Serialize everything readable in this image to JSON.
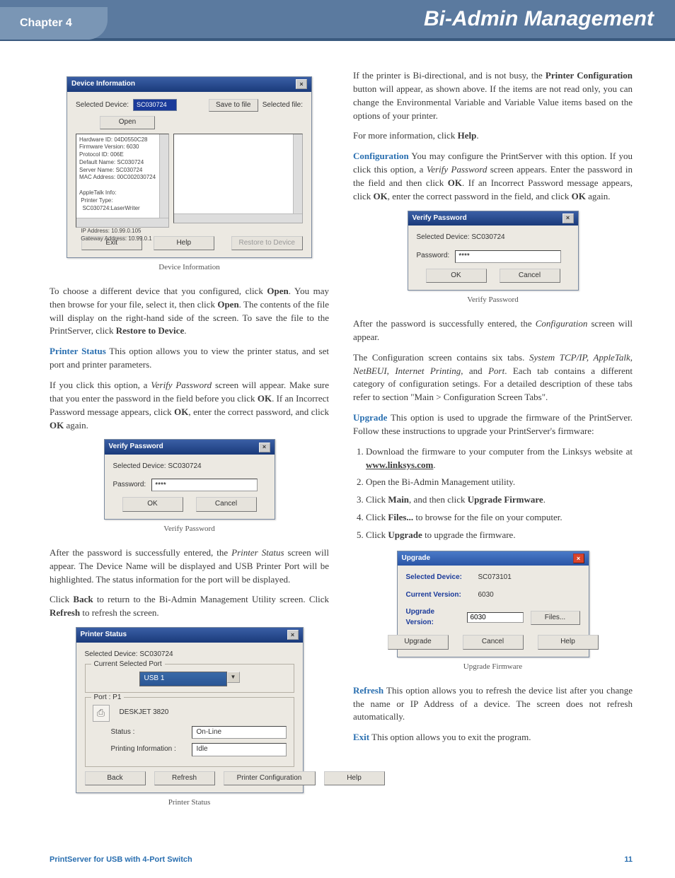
{
  "header": {
    "chapter": "Chapter 4",
    "title": "Bi-Admin Management"
  },
  "footer": {
    "product": "PrintServer for USB with 4-Port Switch",
    "page": "11"
  },
  "left": {
    "dev_info_dialog": {
      "title": "Device Information",
      "selected_label": "Selected Device:",
      "selected_value": "SC030724",
      "save_to_file": "Save to file",
      "selected_file_label": "Selected file:",
      "open": "Open",
      "details": "Hardware ID: 04D0550C28\nFirmware Version: 6030\nProtocol ID: 006E\nDefault Name: SC030724\nServer Name: SC030724\nMAC Address: 00C002030724\n\nAppleTalk Info:\n Printer Type:\n  SC030724:LaserWriter\n\nTCP/IP Info:\n IP Address: 10.99.0.105\n Gateway Address: 10.99.0.1",
      "restore": "Restore to Device",
      "exit": "Exit",
      "help": "Help"
    },
    "caption1": "Device Information",
    "p1a": "To choose a different device that you configured, click ",
    "p1b": ". You may then browse for your file, select it, then click ",
    "p1c": ". The contents of the file will display on the right-hand side of the screen. To save the file to the PrintServer, click ",
    "open_bold": "Open",
    "restore_bold": "Restore to Device",
    "printer_status_label": "Printer Status",
    "p2": " This option allows you to view the printer status, and set port and printer parameters.",
    "p3": "If you click this option, a ",
    "verify_italic": "Verify Password",
    "p3b": " screen will appear. Make sure that you enter the password in the field before you click ",
    "ok_bold": "OK",
    "p3c": ". If an Incorrect Password message appears, click ",
    "p3d": ", enter the correct password, and click ",
    "p3e": " again.",
    "vp_dialog": {
      "title": "Verify Password",
      "selected": "Selected Device:  SC030724",
      "password_label": "Password:",
      "password_value": "****",
      "ok": "OK",
      "cancel": "Cancel"
    },
    "caption2": "Verify Password",
    "p4a": "After the password is successfully entered, the ",
    "p4b": " screen will appear. The Device Name will be displayed and USB Printer Port will be highlighted. The status information for the port will be displayed.",
    "printer_status_italic": "Printer Status",
    "p5a": "Click ",
    "back_bold": "Back",
    "p5b": " to return to the Bi-Admin Management Utility screen. Click ",
    "refresh_bold": "Refresh",
    "p5c": " to refresh the screen.",
    "ps_dialog": {
      "title": "Printer Status",
      "selected": "Selected Device:    SC030724",
      "group1": "Current Selected Port",
      "port_select": "USB 1",
      "group2": "Port : P1",
      "printer": "DESKJET 3820",
      "status_label": "Status :",
      "status_value": "On-Line",
      "printing_label": "Printing Information :",
      "printing_value": "Idle",
      "back": "Back",
      "refresh": "Refresh",
      "printer_config": "Printer Configuration",
      "help": "Help"
    },
    "caption3": "Printer Status"
  },
  "right": {
    "p1a": "If the printer is Bi-directional, and is not busy, the ",
    "printer_config_bold": "Printer Configuration",
    "p1b": " button will appear, as shown above. If the items are not read only, you can change the Environmental Variable and Variable Value items based on the options of your printer.",
    "p2a": "For more information, click ",
    "help_bold": "Help",
    "config_label": "Configuration",
    "p3a": " You may configure the PrintServer with this option. If you click this option, a ",
    "verify_italic": "Verify Password",
    "p3b": " screen appears. Enter the password in the field and then click ",
    "ok_bold": "OK",
    "p3c": ". If an Incorrect Password message appears, click ",
    "p3d": ", enter the correct password in the field, and click ",
    "p3e": " again.",
    "vp_dialog": {
      "title": "Verify Password",
      "selected": "Selected Device:  SC030724",
      "password_label": "Password:",
      "password_value": "****",
      "ok": "OK",
      "cancel": "Cancel"
    },
    "caption1": "Verify Password",
    "p4a": "After the password is successfully entered, the ",
    "config_italic": "Configuration",
    "p4b": " screen will appear.",
    "p5a": "The Configuration screen contains six tabs. ",
    "tabs_list": "System TCP/IP, AppleTalk, NetBEUI, Internet Printing",
    "tabs_and": ", and ",
    "port_italic": "Port",
    "p5b": ". Each tab contains a different category of configuration setings. For a detailed description of these tabs refer to section \"Main > Configuration Screen Tabs\".",
    "upgrade_label": "Upgrade",
    "p6": " This option is used to upgrade the firmware of the PrintServer. Follow these instructions to upgrade your PrintServer's firmware:",
    "steps": {
      "s1a": "Download the firmware to your computer from the Linksys website at ",
      "s1link": "www.linksys.com",
      "s2": "Open the Bi-Admin Management utility.",
      "s3a": "Click ",
      "s3main": "Main",
      "s3b": ", and then click ",
      "s3uf": "Upgrade Firmware",
      "s4a": "Click ",
      "s4files": "Files...",
      "s4b": " to browse for the file on your computer.",
      "s5a": "Click ",
      "s5up": "Upgrade",
      "s5b": " to upgrade the firmware."
    },
    "up_dialog": {
      "title": "Upgrade",
      "sel_label": "Selected Device:",
      "sel_val": "SC073101",
      "cur_label": "Current Version:",
      "cur_val": "6030",
      "upv_label": "Upgrade Version:",
      "upv_val": "6030",
      "files": "Files...",
      "upgrade": "Upgrade",
      "cancel": "Cancel",
      "help": "Help"
    },
    "caption2": "Upgrade Firmware",
    "refresh_label": "Refresh",
    "p7": " This option allows you to refresh the device list after you change the name or IP Address of a device. The screen does not refresh automatically.",
    "exit_label": "Exit",
    "p8": " This option allows you to exit the program."
  }
}
